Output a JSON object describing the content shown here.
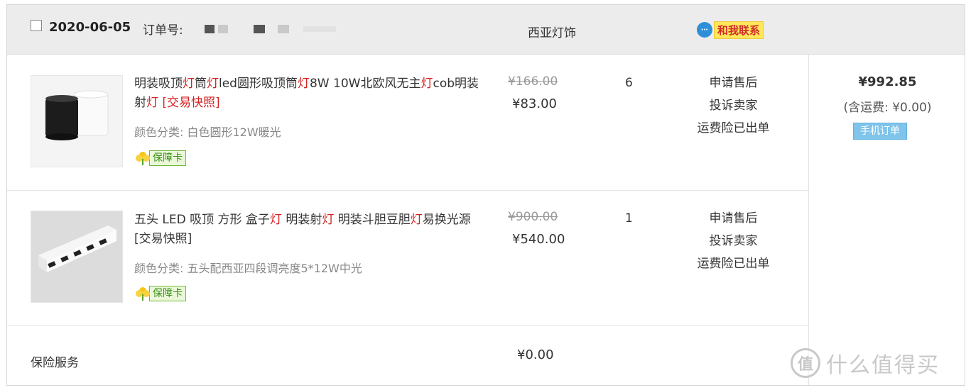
{
  "header": {
    "date": "2020-06-05",
    "order_number_label": "订单号:",
    "shop_name": "西亚灯饰",
    "contact_label": "和我联系"
  },
  "items": [
    {
      "title_parts": [
        {
          "text": "明装吸顶",
          "hl": false
        },
        {
          "text": "灯",
          "hl": true
        },
        {
          "text": "筒",
          "hl": false
        },
        {
          "text": "灯",
          "hl": true
        },
        {
          "text": "led圆形吸顶筒",
          "hl": false
        },
        {
          "text": "灯",
          "hl": true
        },
        {
          "text": "8W 10W北欧风无主",
          "hl": false
        },
        {
          "text": "灯",
          "hl": true
        },
        {
          "text": "cob明装射",
          "hl": false
        },
        {
          "text": "灯",
          "hl": true
        },
        {
          "text": " [交易快照]",
          "hl": true
        }
      ],
      "spec": "颜色分类: 白色圆形12W暖光",
      "guarantee_label": "保障卡",
      "original_price": "¥166.00",
      "price": "¥83.00",
      "quantity": "6",
      "actions": [
        "申请售后",
        "投诉卖家",
        "运费险已出单"
      ]
    },
    {
      "title_parts": [
        {
          "text": "五头 LED 吸顶 方形 盒子",
          "hl": false
        },
        {
          "text": "灯",
          "hl": true
        },
        {
          "text": " 明装射",
          "hl": false
        },
        {
          "text": "灯",
          "hl": true
        },
        {
          "text": " 明装斗胆豆胆",
          "hl": false
        },
        {
          "text": "灯",
          "hl": true
        },
        {
          "text": "易换光源 [交易快照]",
          "hl": false
        }
      ],
      "spec": "颜色分类: 五头配西亚四段调亮度5*12W中光",
      "guarantee_label": "保障卡",
      "original_price": "¥900.00",
      "price": "¥540.00",
      "quantity": "1",
      "actions": [
        "申请售后",
        "投诉卖家",
        "运费险已出单"
      ]
    }
  ],
  "summary": {
    "total": "¥992.85",
    "shipping": "(含运费: ¥0.00)",
    "mobile_order_label": "手机订单"
  },
  "insurance": {
    "label": "保险服务",
    "price": "¥0.00"
  },
  "watermark": {
    "logo_char": "值",
    "text": "什么值得买"
  }
}
